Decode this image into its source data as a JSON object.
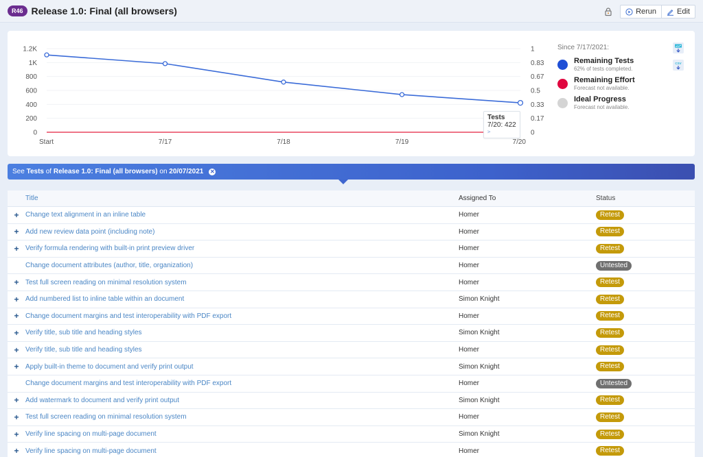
{
  "header": {
    "id_badge": "R46",
    "title": "Release 1.0: Final (all browsers)",
    "rerun_label": "Rerun",
    "edit_label": "Edit"
  },
  "legend": {
    "since": "Since 7/17/2021:",
    "items": [
      {
        "name": "Remaining Tests",
        "sub": "62% of tests completed.",
        "color": "#1f4fd6"
      },
      {
        "name": "Remaining Effort",
        "sub": "Forecast not available.",
        "color": "#e0063f"
      },
      {
        "name": "Ideal Progress",
        "sub": "Forecast not available.",
        "color": "#d4d4d4"
      }
    ],
    "export_chart_icon": "chart-download-icon",
    "export_csv_icon": "csv-download-icon",
    "csv_label": "CSV"
  },
  "tooltip": {
    "title": "Tests",
    "value": "7/20: 422"
  },
  "chart_data": {
    "type": "line",
    "title": "",
    "x": [
      "Start",
      "7/17",
      "7/18",
      "7/19",
      "7/20"
    ],
    "series": [
      {
        "name": "Remaining Tests",
        "axis": "left",
        "color": "#3a6bd8",
        "values": [
          1110,
          985,
          720,
          540,
          422
        ]
      },
      {
        "name": "Remaining Effort",
        "axis": "right",
        "color": "#e8455f",
        "values": [
          0,
          0,
          0,
          0,
          0
        ]
      }
    ],
    "y_left": {
      "ticks": [
        0,
        200,
        400,
        600,
        800,
        1000,
        1200
      ],
      "tick_labels": [
        "0",
        "200",
        "400",
        "600",
        "800",
        "1K",
        "1.2K"
      ],
      "range": [
        0,
        1200
      ]
    },
    "y_right": {
      "ticks": [
        0,
        0.17,
        0.33,
        0.5,
        0.67,
        0.83,
        1
      ],
      "tick_labels": [
        "0",
        "0.17",
        "0.33",
        "0.5",
        "0.67",
        "0.83",
        "1"
      ],
      "range": [
        0,
        1
      ]
    },
    "grid": true,
    "legend": "right"
  },
  "info_bar": {
    "prefix": "See ",
    "entity": "Tests",
    "of": " of ",
    "run": "Release 1.0: Final (all browsers)",
    "on": " on ",
    "date": "20/07/2021"
  },
  "table": {
    "columns": [
      "Title",
      "Assigned To",
      "Status"
    ],
    "rows": [
      {
        "expand": "+",
        "title": "Change text alignment in an inline table",
        "assigned": "Homer",
        "status": "Retest"
      },
      {
        "expand": "+",
        "title": "Add new review data point (including note)",
        "assigned": "Homer",
        "status": "Retest"
      },
      {
        "expand": "+",
        "title": "Verify formula rendering with built-in print preview driver",
        "assigned": "Homer",
        "status": "Retest"
      },
      {
        "expand": "",
        "title": "Change document attributes (author, title, organization)",
        "assigned": "Homer",
        "status": "Untested"
      },
      {
        "expand": "+",
        "title": "Test full screen reading on minimal resolution system",
        "assigned": "Homer",
        "status": "Retest"
      },
      {
        "expand": "+",
        "title": "Add numbered list to inline table within an document",
        "assigned": "Simon Knight",
        "status": "Retest"
      },
      {
        "expand": "+",
        "title": "Change document margins and test interoperability with PDF export",
        "assigned": "Homer",
        "status": "Retest"
      },
      {
        "expand": "+",
        "title": "Verify title, sub title and heading styles",
        "assigned": "Simon Knight",
        "status": "Retest"
      },
      {
        "expand": "+",
        "title": "Verify title, sub title and heading styles",
        "assigned": "Homer",
        "status": "Retest"
      },
      {
        "expand": "+",
        "title": "Apply built-in theme to document and verify print output",
        "assigned": "Simon Knight",
        "status": "Retest"
      },
      {
        "expand": "",
        "title": "Change document margins and test interoperability with PDF export",
        "assigned": "Homer",
        "status": "Untested"
      },
      {
        "expand": "+",
        "title": "Add watermark to document and verify print output",
        "assigned": "Simon Knight",
        "status": "Retest"
      },
      {
        "expand": "+",
        "title": "Test full screen reading on minimal resolution system",
        "assigned": "Homer",
        "status": "Retest"
      },
      {
        "expand": "+",
        "title": "Verify line spacing on multi-page document",
        "assigned": "Simon Knight",
        "status": "Retest"
      },
      {
        "expand": "+",
        "title": "Verify line spacing on multi-page document",
        "assigned": "Homer",
        "status": "Retest"
      }
    ]
  }
}
